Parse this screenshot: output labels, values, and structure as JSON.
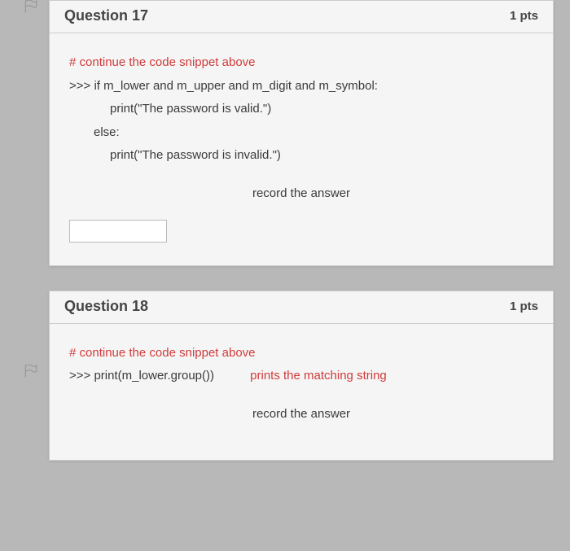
{
  "questions": [
    {
      "title": "Question 17",
      "pts": "1 pts",
      "comment": "# continue the code snippet above",
      "lines": [
        ">>> if m_lower and m_upper and m_digit and m_symbol:",
        "print(\"The password is valid.\")",
        "else:",
        "print(\"The password is invalid.\")"
      ],
      "prompt": "record the answer"
    },
    {
      "title": "Question 18",
      "pts": "1 pts",
      "comment": "# continue the code snippet above",
      "line_prefix": ">>> print(m_lower.group())",
      "annotation": "prints the matching string",
      "prompt": "record the answer"
    }
  ]
}
